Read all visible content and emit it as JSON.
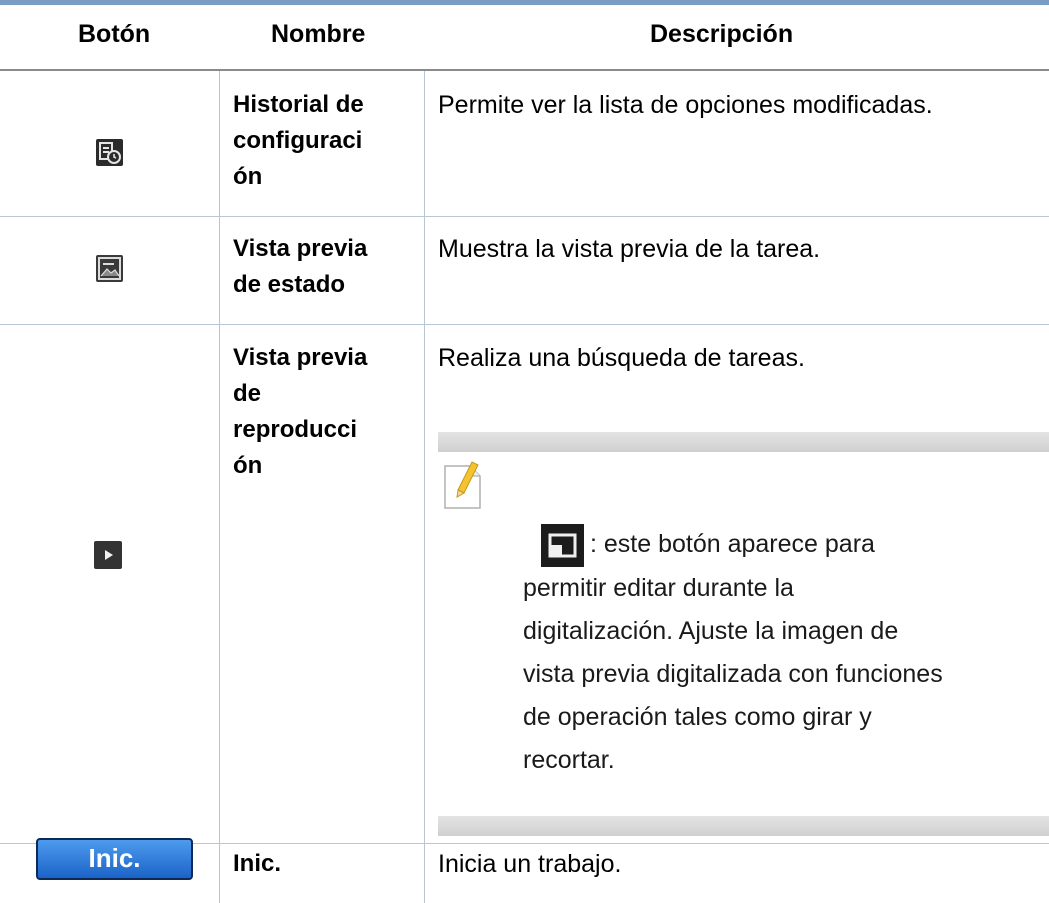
{
  "header": {
    "col_button": "Botón",
    "col_name": "Nombre",
    "col_description": "Descripción"
  },
  "rows": [
    {
      "name_lines": [
        "Historial de",
        "configuraci",
        "ón"
      ],
      "icon": "settings-history-icon",
      "description": "Permite ver la lista de opciones modificadas."
    },
    {
      "name_lines": [
        "Vista previa",
        "de estado"
      ],
      "icon": "preview-image-icon",
      "description": "Muestra la vista previa de la tarea."
    },
    {
      "name_lines": [
        "Vista previa",
        "de",
        "reproducci",
        "ón"
      ],
      "icon": "play-icon",
      "description": "Realiza una búsqueda de tareas.",
      "note": {
        "icon": "note-pencil-icon",
        "inline_icon": "crop-edit-icon",
        "lines": [
          ": este botón aparece para",
          "permitir editar durante la",
          "digitalización. Ajuste la imagen de",
          "vista previa digitalizada con funciones",
          "de operación tales como girar y",
          "recortar."
        ]
      }
    },
    {
      "name_lines": [
        "Inic."
      ],
      "button_label": "Inic.",
      "description": "Inicia un trabajo."
    }
  ],
  "colors": {
    "top_rule": "#7b9cc2",
    "start_button": "#2b7ad6"
  }
}
